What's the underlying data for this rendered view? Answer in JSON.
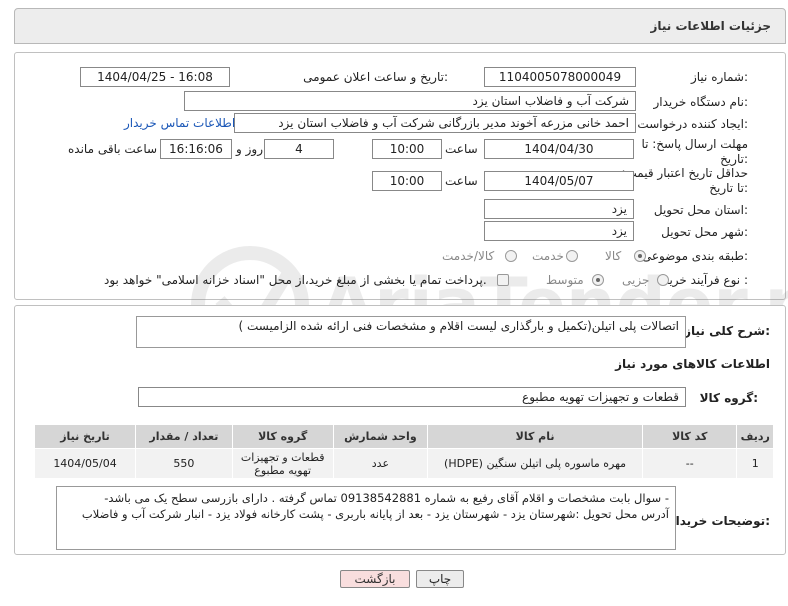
{
  "header": {
    "title": "جزئیات اطلاعات نیاز"
  },
  "form": {
    "need_number": {
      "label": "شماره نیاز:",
      "value": "1104005078000049"
    },
    "announce_datetime": {
      "label": "تاریخ و ساعت اعلان عمومی:",
      "value": "1404/04/25 - 16:08"
    },
    "buyer_org": {
      "label": "نام دستگاه خریدار:",
      "value": "شرکت آب و فاضلاب استان یزد"
    },
    "requester": {
      "label": "ایجاد کننده درخواست:",
      "value": "احمد خانی مزرعه آخوند مدیر بازرگانی شرکت آب و فاضلاب استان یزد",
      "link": "اطلاعات تماس خریدار"
    },
    "deadline": {
      "label": "مهلت ارسال پاسخ: تا تاریخ:",
      "date": "1404/04/30",
      "time_label": "ساعت",
      "time": "10:00",
      "days": "4",
      "days_label": "روز و",
      "remaining": "16:16:06",
      "remaining_label": "ساعت باقی مانده"
    },
    "price_validity": {
      "label": "حداقل تاریخ اعتبار قیمت: تا تاریخ:",
      "date": "1404/05/07",
      "time_label": "ساعت",
      "time": "10:00"
    },
    "province": {
      "label": "استان محل تحویل:",
      "value": "یزد"
    },
    "city": {
      "label": "شهر محل تحویل:",
      "value": "یزد"
    },
    "category": {
      "label": "طبقه بندی موضوعی:",
      "options": [
        "کالا",
        "خدمت",
        "کالا/خدمت"
      ]
    },
    "process": {
      "label": "نوع فرآیند خرید :",
      "options": [
        "جزیی",
        "متوسط"
      ],
      "note": "پرداخت تمام یا بخشی از مبلغ خرید،از محل \"اسناد خزانه اسلامی\" خواهد بود."
    }
  },
  "description": {
    "label": "شرح کلی نیاز:",
    "value": "اتصالات پلی اتیلن(تکمیل و بارگذاری لیست اقلام و مشخصات فنی ارائه شده الزامیست )"
  },
  "goods_info": {
    "title": "اطلاعات کالاهای مورد نیاز",
    "group_label": "گروه کالا:",
    "group_value": "قطعات و تجهیزات تهویه مطبوع"
  },
  "table": {
    "headers": [
      "ردیف",
      "کد کالا",
      "نام کالا",
      "واحد شمارش",
      "گروه کالا",
      "تعداد / مقدار",
      "تاریخ نیاز"
    ],
    "rows": [
      [
        "1",
        "--",
        "مهره ماسوره پلی اتیلن سنگین (HDPE)",
        "عدد",
        "قطعات و تجهیزات تهویه مطبوع",
        "550",
        "1404/05/04"
      ]
    ]
  },
  "buyer_notes": {
    "label": "توضیحات خریدار:",
    "line1": "-       سوال بابت مشخصات و اقلام آقای رفیع به شماره 09138542881 تماس گرفته . دارای بازرسی سطح یک می باشد-",
    "line2": "آدرس محل تحویل :شهرستان یزد - شهرستان یزد - بعد از پایانه باربری - پشت کارخانه فولاد یزد - انبار شرکت آب و فاضلاب"
  },
  "buttons": {
    "print": "چاپ",
    "back": "بازگشت"
  },
  "watermark": "AriaTender.net",
  "colors": {
    "link": "#1b57b7",
    "back_button": "#f9dede",
    "print_button": "#ececec"
  }
}
